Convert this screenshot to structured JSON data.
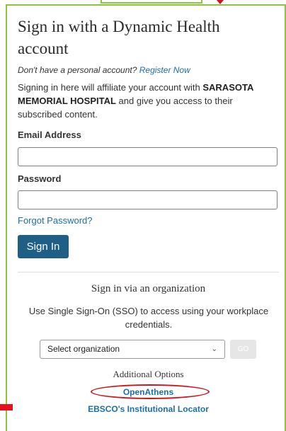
{
  "page": {
    "title": "Sign in with a Dynamic Health account",
    "no_account_text": "Don't have a personal account?",
    "register_link": "Register Now",
    "affiliate_pre": "Signing in here will affiliate your account with",
    "affiliate_org": "SARASOTA MEMORIAL HOSPITAL",
    "affiliate_post": "and give you access to their subscribed content."
  },
  "form": {
    "email_label": "Email Address",
    "email_value": "",
    "password_label": "Password",
    "password_value": "",
    "forgot_password": "Forgot Password?",
    "sign_in_button": "Sign In"
  },
  "organization": {
    "title": "Sign in via an organization",
    "description": "Use Single Sign-On (SSO) to access using your workplace credentials.",
    "select_value": "Select organization",
    "go_button": "GO"
  },
  "additional": {
    "title": "Additional Options",
    "openathens": "OpenAthens",
    "locator": "EBSCO's Institutional Locator"
  },
  "colors": {
    "accent_border": "#8cc63e",
    "annotation_red": "#d0121b",
    "link": "#1d6fa5",
    "primary_button": "#1f5f86"
  }
}
